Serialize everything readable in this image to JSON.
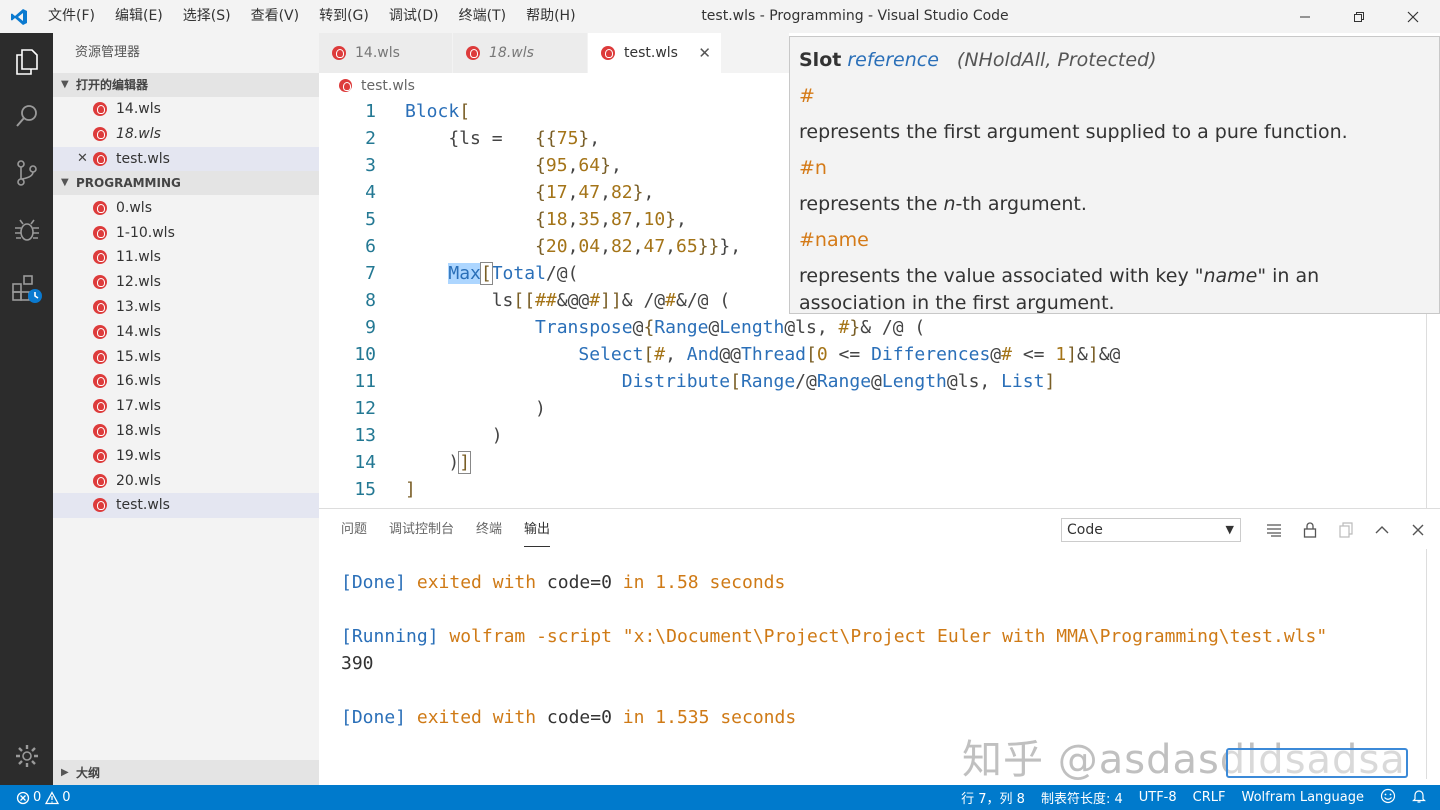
{
  "titlebar": {
    "menu": [
      "文件(F)",
      "编辑(E)",
      "选择(S)",
      "查看(V)",
      "转到(G)",
      "调试(D)",
      "终端(T)",
      "帮助(H)"
    ],
    "window_title": "test.wls - Programming - Visual Studio Code"
  },
  "sidebar": {
    "title": "资源管理器",
    "open_editors_header": "打开的编辑器",
    "open_editors": [
      {
        "name": "14.wls"
      },
      {
        "name": "18.wls"
      },
      {
        "name": "test.wls"
      }
    ],
    "folder_header": "PROGRAMMING",
    "files": [
      "0.wls",
      "1-10.wls",
      "11.wls",
      "12.wls",
      "13.wls",
      "14.wls",
      "15.wls",
      "16.wls",
      "17.wls",
      "18.wls",
      "19.wls",
      "20.wls",
      "test.wls"
    ],
    "outline_header": "大纲"
  },
  "tabs": [
    {
      "label": "14.wls"
    },
    {
      "label": "18.wls"
    },
    {
      "label": "test.wls"
    }
  ],
  "breadcrumb": "test.wls",
  "code": {
    "line_numbers": [
      "1",
      "2",
      "3",
      "4",
      "5",
      "6",
      "7",
      "8",
      "9",
      "10",
      "11",
      "12",
      "13",
      "14",
      "15"
    ]
  },
  "hover": {
    "slot": "Slot",
    "reference": "reference",
    "attributes": "(NHoldAll, Protected)",
    "sym1": "#",
    "desc1": "represents the first argument supplied to a pure function.",
    "sym2": "#n",
    "desc2_pre": "represents the ",
    "desc2_em": "n",
    "desc2_post": "-th argument.",
    "sym3": "#name",
    "desc3_pre": "represents the value associated with key \"",
    "desc3_em": "name",
    "desc3_post": "\" in an association in the first argument."
  },
  "panel": {
    "tabs": [
      "问题",
      "调试控制台",
      "终端",
      "输出"
    ],
    "channel": "Code",
    "output": {
      "line1_tag": "[Done]",
      "line1_rest": " exited with ",
      "line1_code": "code=0",
      "line1_tail": " in 1.58 seconds",
      "line2_tag": "[Running]",
      "line2_rest": " wolfram -script \"x:\\Document\\Project\\Project Euler with MMA\\Programming\\test.wls\"",
      "line3": "390",
      "line4_tag": "[Done]",
      "line4_rest": " exited with ",
      "line4_code": "code=0",
      "line4_tail": " in 1.535 seconds"
    }
  },
  "watermark": "知乎 @asdasdldsadsa",
  "statusbar": {
    "errors": "0",
    "warnings": "0",
    "position": "行 7，列 8",
    "tab_size": "制表符长度: 4",
    "encoding": "UTF-8",
    "eol": "CRLF",
    "language": "Wolfram Language"
  }
}
